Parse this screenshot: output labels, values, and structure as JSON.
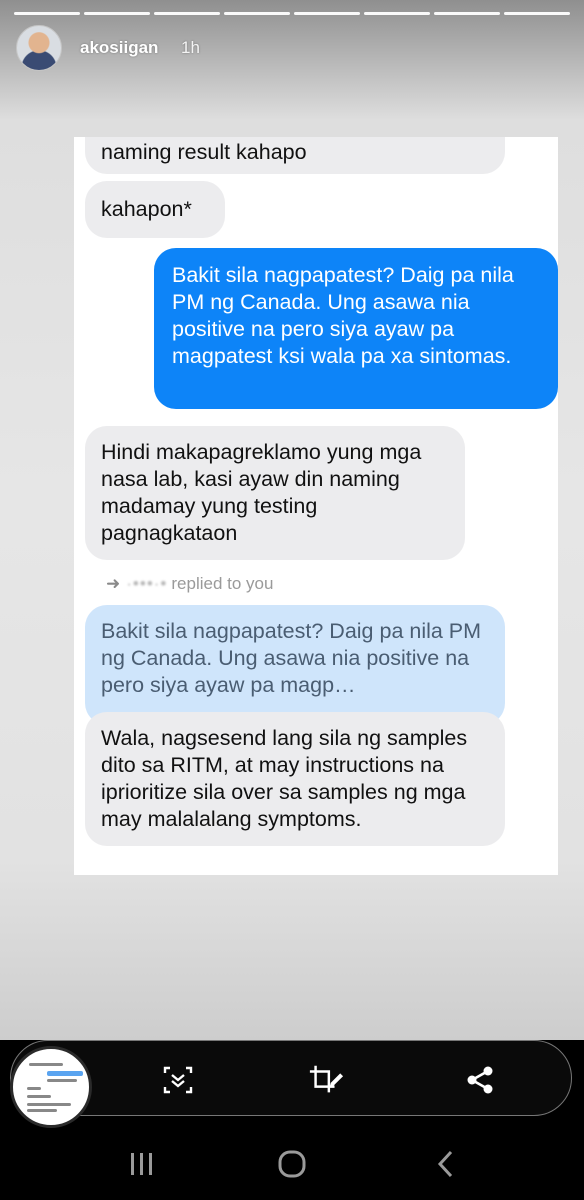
{
  "story": {
    "username": "akosiigan",
    "time": "1h",
    "progress_segments": 8
  },
  "conversation": {
    "msg1": "naming result kahapo",
    "msg2": "kahapon*",
    "msg3": "Bakit sila nagpapatest? Daig pa nila PM ng Canada. Ung asawa nia positive na pero siya ayaw pa magpatest ksi wala pa xa sintomas.",
    "msg4": "Hindi makapagreklamo yung mga nasa lab, kasi ayaw din naming madamay yung testing pagnagkataon",
    "reply_label": "replied to you",
    "quoted": "Bakit sila nagpapatest? Daig pa nila PM ng Canada. Ung asawa nia positive na pero siya ayaw pa magp…",
    "msg5": "Wala, nagsesend lang sila ng samples dito sa RITM, at may instructions na iprioritize sila over sa samples ng mga may malalalang symptoms."
  },
  "toolbar": {
    "icons": [
      "screenshot-thumbnail",
      "scroll-capture-icon",
      "crop-edit-icon",
      "share-icon"
    ]
  },
  "nav": {
    "icons": [
      "recent-apps-icon",
      "home-icon",
      "back-icon"
    ]
  },
  "colors": {
    "blue_bubble": "#0d84f8",
    "gray_bubble": "#ececee",
    "quoted_bubble": "#cfe5fb"
  }
}
